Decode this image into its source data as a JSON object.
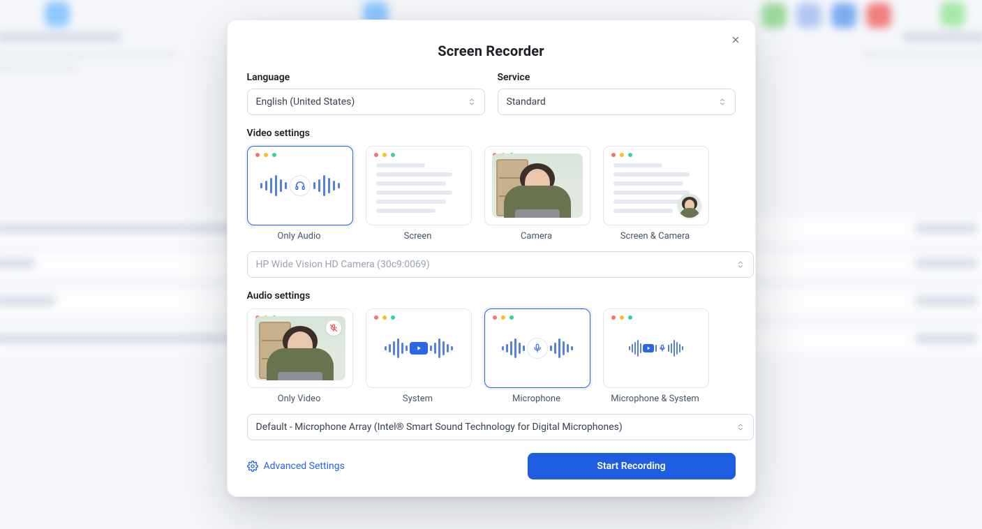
{
  "modal": {
    "title": "Screen Recorder",
    "language_label": "Language",
    "language_value": "English (United States)",
    "service_label": "Service",
    "service_value": "Standard",
    "video_settings_label": "Video settings",
    "video_tiles": [
      {
        "label": "Only Audio",
        "selected": true
      },
      {
        "label": "Screen",
        "selected": false
      },
      {
        "label": "Camera",
        "selected": false
      },
      {
        "label": "Screen & Camera",
        "selected": false
      }
    ],
    "camera_device": "HP Wide Vision HD Camera (30c9:0069)",
    "audio_settings_label": "Audio settings",
    "audio_tiles": [
      {
        "label": "Only Video",
        "selected": false
      },
      {
        "label": "System",
        "selected": false
      },
      {
        "label": "Microphone",
        "selected": true
      },
      {
        "label": "Microphone & System",
        "selected": false
      }
    ],
    "mic_device": "Default - Microphone Array (Intel® Smart Sound Technology for Digital Microphones)",
    "advanced_settings": "Advanced Settings",
    "start_button": "Start Recording"
  }
}
